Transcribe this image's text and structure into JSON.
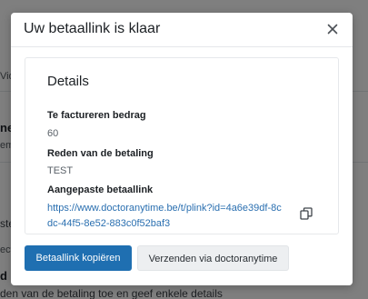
{
  "background": {
    "frag_1": "Vid",
    "frag_2": "ne",
    "frag_3": "em",
    "frag_4": "ste",
    "frag_5": "ect",
    "frag_6": "d",
    "footer_text": "den van de betaling toe en geef enkele details"
  },
  "modal": {
    "title": "Uw betaallink is klaar",
    "close_icon": "close-icon",
    "details_heading": "Details",
    "amount_label": "Te factureren bedrag",
    "amount_value": "60",
    "reason_label": "Reden van de betaling",
    "reason_value": "TEST",
    "link_label": "Aangepaste betaallink",
    "link_value": "https://www.doctoranytime.be/t/plink?id=4a6e39df-8cdc-44f5-8e52-883c0f52baf3",
    "copy_icon": "copy-icon",
    "copy_button_label": "Betaallink kopiëren",
    "send_button_label": "Verzenden via doctoranytime"
  },
  "colors": {
    "primary": "#1f6fb1",
    "link": "#2a6fb0",
    "overlay": "rgba(0,0,0,0.5)"
  }
}
